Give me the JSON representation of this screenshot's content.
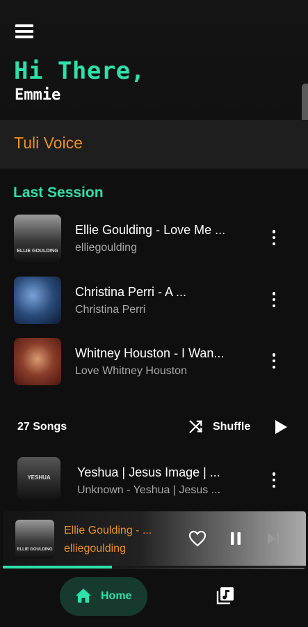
{
  "greeting": "Hi There,",
  "user_name": "Emmie",
  "voice_label": "Tuli Voice",
  "last_session": {
    "title": "Last Session",
    "items": [
      {
        "title": "Ellie Goulding - Love Me ...",
        "artist": "elliegoulding",
        "thumb_text": "ELLIE GOULDING"
      },
      {
        "title": "Christina Perri - A ...",
        "artist": "Christina Perri"
      },
      {
        "title": "Whitney Houston - I Wan...",
        "artist": "Love Whitney Houston"
      }
    ]
  },
  "songs_bar": {
    "count_label": "27 Songs",
    "shuffle_label": "Shuffle"
  },
  "songs": [
    {
      "title": "Yeshua | Jesus Image | ...",
      "artist": "Unknown - Yeshua | Jesus ...",
      "thumb_text": "YESHUA"
    }
  ],
  "now_playing": {
    "title": "Ellie Goulding - ...",
    "artist": "elliegoulding",
    "thumb_text": "ELLIE GOULDING",
    "progress": 0.36
  },
  "bottom_nav": {
    "home_label": "Home"
  },
  "colors": {
    "accent": "#2fe0a8",
    "orange": "#e8902a",
    "background": "#0f0f0f"
  }
}
